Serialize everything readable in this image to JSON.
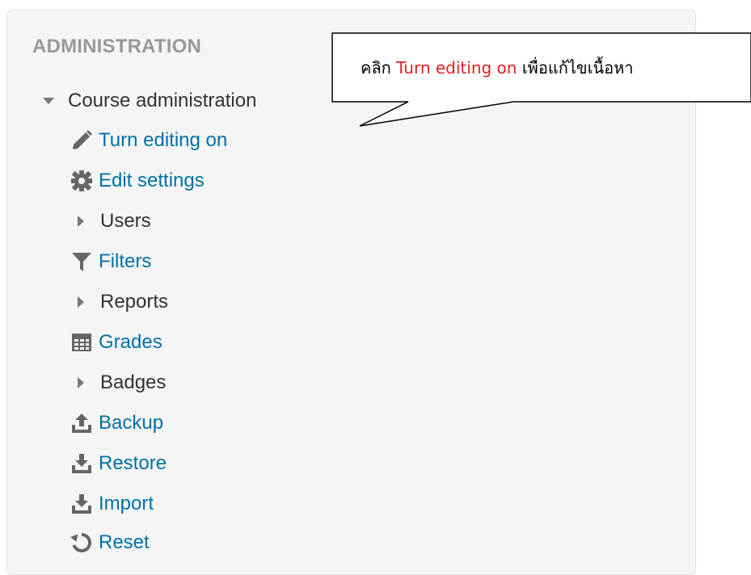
{
  "block": {
    "title": "ADMINISTRATION"
  },
  "tree": {
    "root": {
      "label": "Course administration",
      "icon": "caret-down-icon"
    },
    "items": [
      {
        "label": "Turn editing on",
        "icon": "pencil-icon",
        "type": "link"
      },
      {
        "label": "Edit settings",
        "icon": "gear-icon",
        "type": "link"
      },
      {
        "label": "Users",
        "icon": "caret-right-icon",
        "type": "branch"
      },
      {
        "label": "Filters",
        "icon": "filter-icon",
        "type": "link"
      },
      {
        "label": "Reports",
        "icon": "caret-right-icon",
        "type": "branch"
      },
      {
        "label": "Grades",
        "icon": "table-icon",
        "type": "link"
      },
      {
        "label": "Badges",
        "icon": "caret-right-icon",
        "type": "branch"
      },
      {
        "label": "Backup",
        "icon": "upload-icon",
        "type": "link"
      },
      {
        "label": "Restore",
        "icon": "download-icon",
        "type": "link"
      },
      {
        "label": "Import",
        "icon": "download-icon",
        "type": "link"
      },
      {
        "label": "Reset",
        "icon": "reset-icon",
        "type": "link"
      }
    ]
  },
  "callout": {
    "prefix": "คลิก ",
    "highlight": "Turn editing on",
    "suffix": " เพื่อแก้ไขเนื้อหา"
  },
  "colors": {
    "link": "#0070a8",
    "text": "#333333",
    "title": "#999999",
    "icon": "#666666",
    "highlight": "#e02020"
  }
}
